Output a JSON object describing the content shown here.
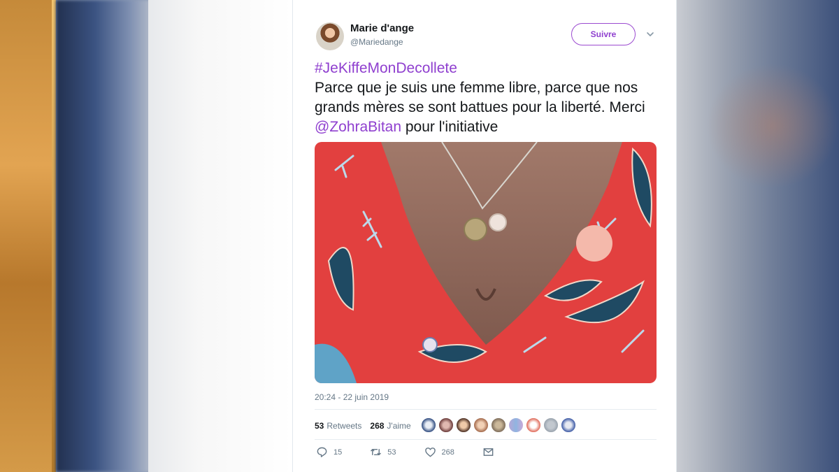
{
  "tweet": {
    "author_name": "Marie d'ange",
    "author_handle": "@Mariedange",
    "follow_label": "Suivre",
    "hashtag": "#JeKiffeMonDecollete",
    "text_part1": "Parce que je suis une femme libre, parce que nos grands mères se sont battues pour la liberté. Merci ",
    "mention": "@ZohraBitan",
    "text_part2": " pour l'initiative",
    "timestamp": "20:24 - 22 juin 2019",
    "retweets_count": "53",
    "retweets_label": "Retweets",
    "likes_count": "268",
    "likes_label": "J'aime",
    "action_reply_count": "15",
    "action_retweet_count": "53",
    "action_like_count": "268"
  },
  "colors": {
    "accent": "#8f3fcf",
    "text": "#14171a",
    "muted": "#657786"
  },
  "icons": {
    "reply": "reply-icon",
    "retweet": "retweet-icon",
    "like": "heart-icon",
    "message": "envelope-icon",
    "more": "chevron-down-icon"
  }
}
